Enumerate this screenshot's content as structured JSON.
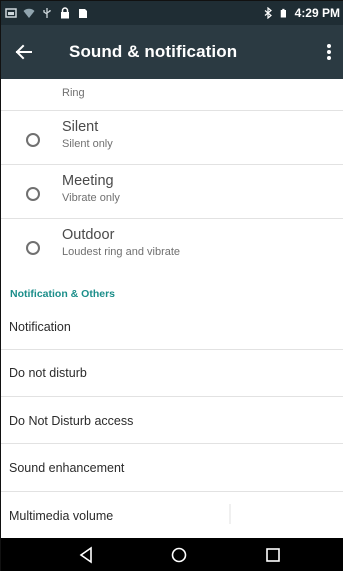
{
  "status_bar": {
    "time": "4:29 PM",
    "icons_left": [
      "screenshot-icon",
      "wifi-icon",
      "usb-icon",
      "lock-icon",
      "sd-card-icon"
    ],
    "icons_right": [
      "bluetooth-icon",
      "battery-icon"
    ]
  },
  "app_bar": {
    "title": "Sound & notification",
    "back_icon": "arrow-left-icon",
    "more_icon": "more-vert-icon"
  },
  "profiles": [
    {
      "title": "",
      "subtitle": "Ring"
    },
    {
      "title": "Silent",
      "subtitle": "Silent only"
    },
    {
      "title": "Meeting",
      "subtitle": "Vibrate only"
    },
    {
      "title": "Outdoor",
      "subtitle": "Loudest ring and vibrate"
    }
  ],
  "section": {
    "header": "Notification & Others"
  },
  "settings": [
    {
      "label": "Notification"
    },
    {
      "label": "Do not disturb"
    },
    {
      "label": "Do Not Disturb access"
    },
    {
      "label": "Sound enhancement"
    },
    {
      "label": "Multimedia volume"
    }
  ],
  "nav_bar": {
    "icons": [
      "back-triangle-icon",
      "home-circle-icon",
      "recents-square-icon"
    ]
  },
  "colors": {
    "status_bar": "#1f2d34",
    "app_bar": "#2b3a42",
    "accent": "#1b8e8a"
  }
}
